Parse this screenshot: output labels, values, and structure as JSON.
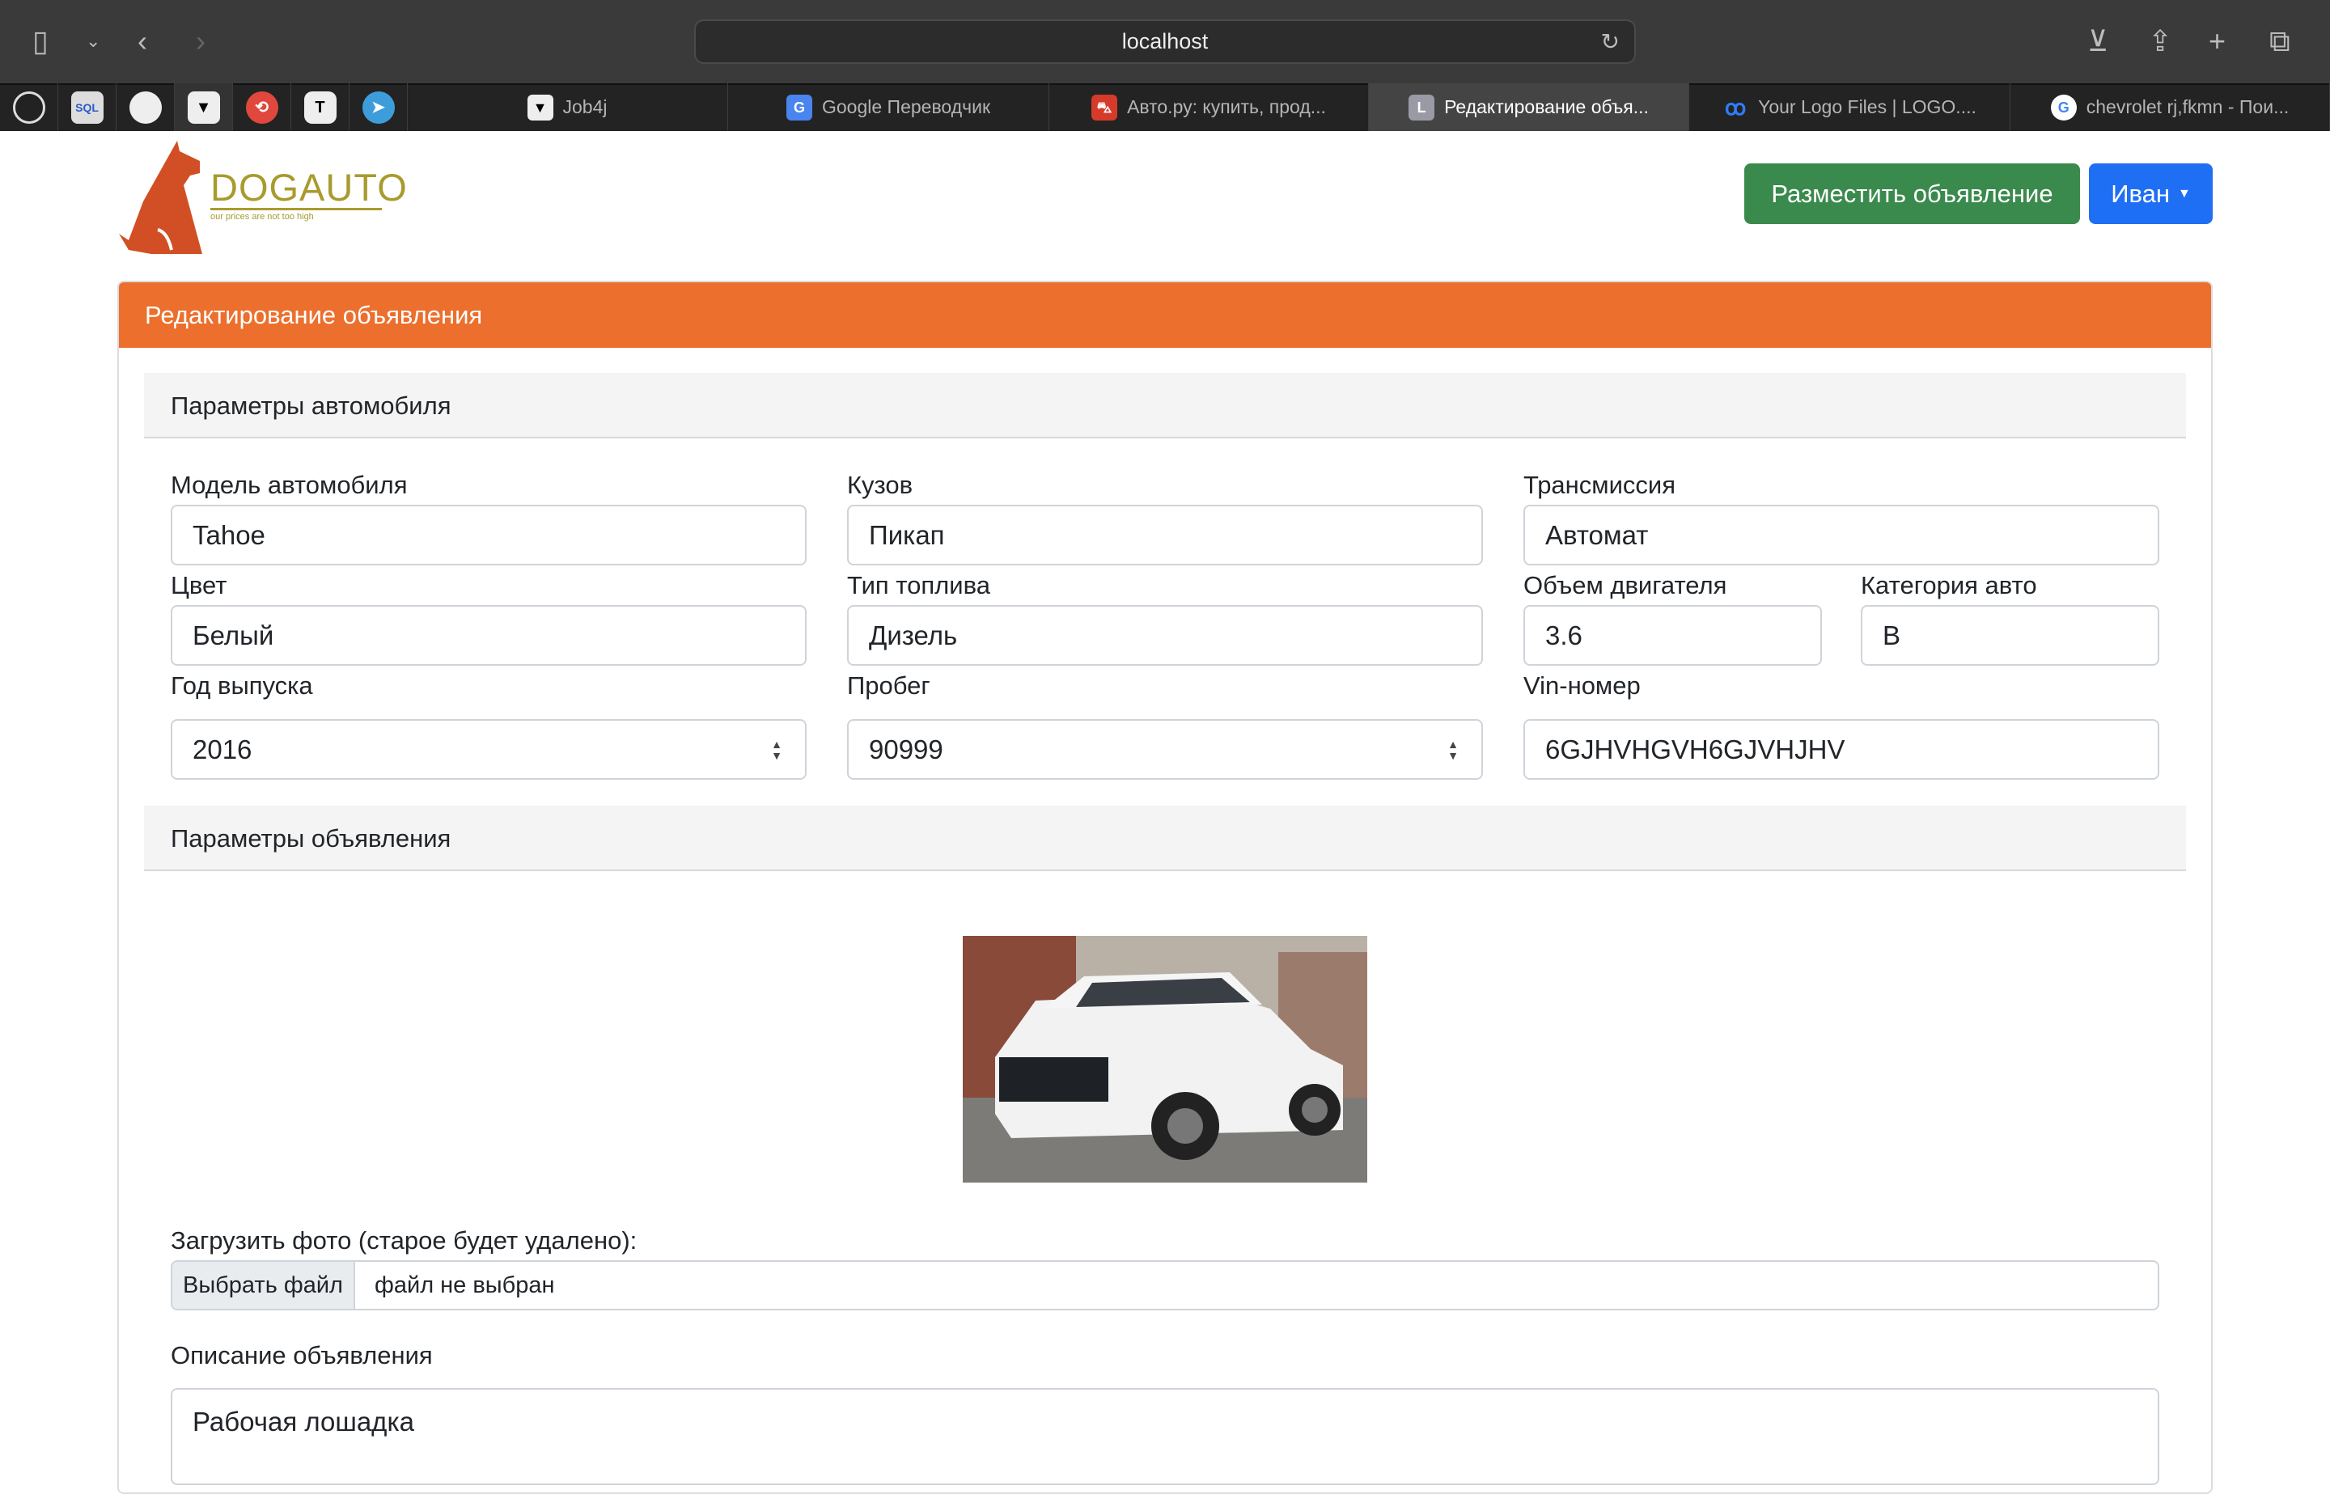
{
  "browser": {
    "address": "localhost",
    "pinned_tabs": [
      {
        "icon": "github-check-icon"
      },
      {
        "icon": "sql-cloud-icon"
      },
      {
        "icon": "github-icon"
      },
      {
        "icon": "job4j-icon"
      },
      {
        "icon": "red-swirl-icon"
      },
      {
        "icon": "t-circle-icon"
      },
      {
        "icon": "telegram-icon"
      }
    ],
    "tabs": [
      {
        "label": "Job4j",
        "icon": "job4j-icon",
        "active": false
      },
      {
        "label": "Google Переводчик",
        "icon": "google-translate-icon",
        "active": false
      },
      {
        "label": "Авто.ру: купить, прод...",
        "icon": "autoru-icon",
        "active": false
      },
      {
        "label": "Редактирование объя...",
        "icon": "L",
        "active": true
      },
      {
        "label": "Your Logo Files | LOGO....",
        "icon": "logo-files-icon",
        "active": false
      },
      {
        "label": "chevrolet rj,fkmn - Пои...",
        "icon": "google-icon",
        "active": false
      }
    ]
  },
  "header": {
    "logo_text": "DOGAUTO",
    "logo_tagline": "our prices are not too high",
    "post_ad_label": "Разместить объявление",
    "user_label": "Иван",
    "colors": {
      "green": "#3b8a4d",
      "blue": "#1f6ff5",
      "orange": "#ec6f2d"
    }
  },
  "card": {
    "title": "Редактирование объявления",
    "car_section": "Параметры автомобиля",
    "fields": {
      "model": {
        "label": "Модель автомобиля",
        "value": "Tahoe"
      },
      "body": {
        "label": "Кузов",
        "value": "Пикап"
      },
      "transmission": {
        "label": "Трансмиссия",
        "value": "Автомат"
      },
      "color": {
        "label": "Цвет",
        "value": "Белый"
      },
      "fuel": {
        "label": "Тип топлива",
        "value": "Дизель"
      },
      "engine": {
        "label": "Объем двигателя",
        "value": "3.6"
      },
      "category": {
        "label": "Категория авто",
        "value": "B"
      },
      "year": {
        "label": "Год выпуска",
        "value": "2016"
      },
      "mileage": {
        "label": "Пробег",
        "value": "90999"
      },
      "vin": {
        "label": "Vin-номер",
        "value": "6GJHVHGVH6GJVHJHV"
      }
    },
    "ad_section": "Параметры объявления",
    "upload_label": "Загрузить фото (старое будет удалено):",
    "choose_file": "Выбрать файл",
    "no_file": "файл не выбран",
    "description_label": "Описание объявления",
    "description": "Рабочая лошадка"
  }
}
